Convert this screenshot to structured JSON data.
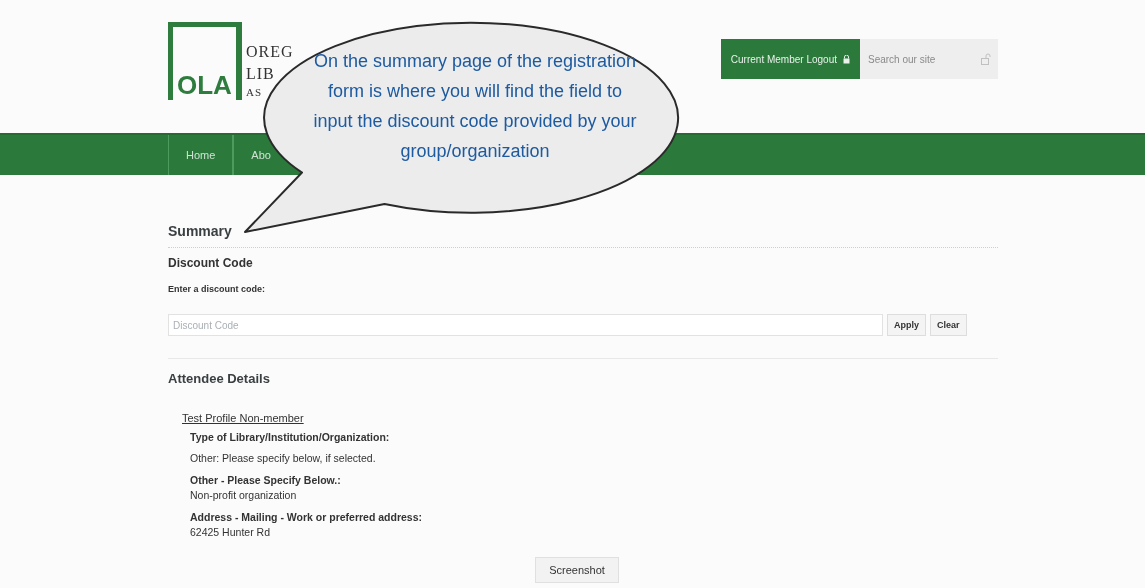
{
  "header": {
    "logo": {
      "mark": "OLA",
      "name_lines": [
        "OREG",
        "LIB",
        "AS"
      ]
    },
    "logout_button": {
      "label": "Current Member Logout"
    },
    "search": {
      "placeholder": "Search our site"
    }
  },
  "nav": {
    "items": [
      {
        "label": "Home",
        "selected": false
      },
      {
        "label": "Abo",
        "selected": false
      }
    ]
  },
  "callout": {
    "text": "On the summary page of the registration form is where you will find the field to input the discount code provided by your group/organization"
  },
  "summary": {
    "title": "Summary",
    "discount": {
      "heading": "Discount Code",
      "label": "Enter a discount code:",
      "placeholder": "Discount Code",
      "buttons": [
        "Apply",
        "Clear"
      ]
    }
  },
  "attendee": {
    "heading": "Attendee Details",
    "name": "Test Profile Non-member",
    "fields": [
      {
        "label": "Type of Library/Institution/Organization:",
        "value": "Other: Please specify below, if selected."
      },
      {
        "label": "Other - Please Specify Below.:",
        "value": "Non-profit organization"
      },
      {
        "label": "Address - Mailing - Work or preferred address:",
        "value": "62425 Hunter Rd"
      }
    ]
  },
  "screenshot_button": {
    "label": "Screenshot"
  }
}
